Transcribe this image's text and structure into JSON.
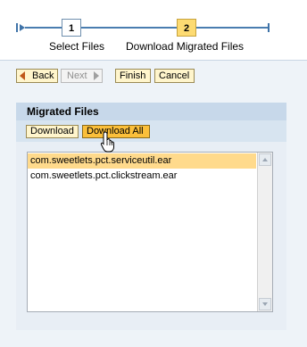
{
  "roadmap": {
    "steps": [
      {
        "number": "1",
        "label": "Select Files"
      },
      {
        "number": "2",
        "label": "Download Migrated Files"
      }
    ]
  },
  "toolbar": {
    "back_label": "Back",
    "next_label": "Next",
    "finish_label": "Finish",
    "cancel_label": "Cancel"
  },
  "panel": {
    "title": "Migrated Files",
    "download_label": "Download",
    "download_all_label": "Download All",
    "files": [
      {
        "name": "com.sweetlets.pct.serviceutil.ear",
        "selected": true
      },
      {
        "name": "com.sweetlets.pct.clickstream.ear",
        "selected": false
      }
    ]
  },
  "colors": {
    "accent": "#fbbf3a",
    "selection": "#ffda8c",
    "panel_header": "#c7d8ea",
    "roadmap_line": "#4a7db0"
  },
  "icons": {
    "roadmap_start": "roadmap-start-icon",
    "roadmap_end": "roadmap-end-icon",
    "back": "triangle-left-icon",
    "next": "triangle-right-icon",
    "cursor": "hand-pointer-icon"
  }
}
